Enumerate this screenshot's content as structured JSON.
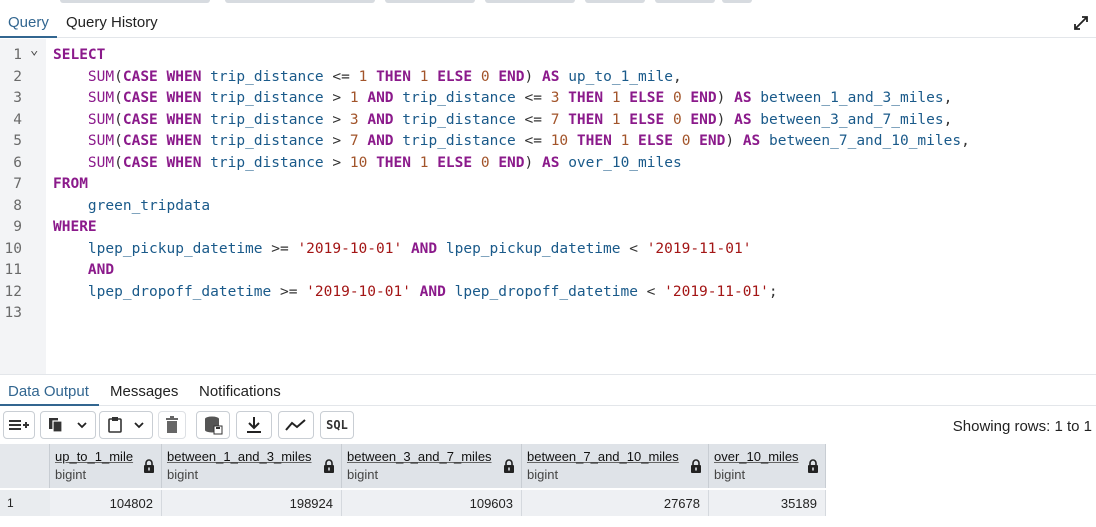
{
  "editor_tabs": [
    "Query",
    "Query History"
  ],
  "editor": {
    "lines": [
      {
        "n": "1",
        "fold": true,
        "tokens": [
          [
            "kw",
            "SELECT"
          ]
        ]
      },
      {
        "n": "2",
        "tokens": [
          [
            "sp",
            "    "
          ],
          [
            "fn",
            "SUM"
          ],
          [
            "op",
            "("
          ],
          [
            "kw",
            "CASE WHEN"
          ],
          [
            "op",
            " "
          ],
          [
            "id",
            "trip_distance"
          ],
          [
            "op",
            " <= "
          ],
          [
            "num",
            "1"
          ],
          [
            "op",
            " "
          ],
          [
            "kw",
            "THEN"
          ],
          [
            "op",
            " "
          ],
          [
            "num",
            "1"
          ],
          [
            "op",
            " "
          ],
          [
            "kw",
            "ELSE"
          ],
          [
            "op",
            " "
          ],
          [
            "num",
            "0"
          ],
          [
            "op",
            " "
          ],
          [
            "kw",
            "END"
          ],
          [
            "op",
            ") "
          ],
          [
            "kw",
            "AS"
          ],
          [
            "op",
            " "
          ],
          [
            "id",
            "up_to_1_mile"
          ],
          [
            "op",
            ","
          ]
        ]
      },
      {
        "n": "3",
        "tokens": [
          [
            "sp",
            "    "
          ],
          [
            "fn",
            "SUM"
          ],
          [
            "op",
            "("
          ],
          [
            "kw",
            "CASE WHEN"
          ],
          [
            "op",
            " "
          ],
          [
            "id",
            "trip_distance"
          ],
          [
            "op",
            " > "
          ],
          [
            "num",
            "1"
          ],
          [
            "op",
            " "
          ],
          [
            "kw",
            "AND"
          ],
          [
            "op",
            " "
          ],
          [
            "id",
            "trip_distance"
          ],
          [
            "op",
            " <= "
          ],
          [
            "num",
            "3"
          ],
          [
            "op",
            " "
          ],
          [
            "kw",
            "THEN"
          ],
          [
            "op",
            " "
          ],
          [
            "num",
            "1"
          ],
          [
            "op",
            " "
          ],
          [
            "kw",
            "ELSE"
          ],
          [
            "op",
            " "
          ],
          [
            "num",
            "0"
          ],
          [
            "op",
            " "
          ],
          [
            "kw",
            "END"
          ],
          [
            "op",
            ") "
          ],
          [
            "kw",
            "AS"
          ],
          [
            "op",
            " "
          ],
          [
            "id",
            "between_1_and_3_miles"
          ],
          [
            "op",
            ","
          ]
        ]
      },
      {
        "n": "4",
        "tokens": [
          [
            "sp",
            "    "
          ],
          [
            "fn",
            "SUM"
          ],
          [
            "op",
            "("
          ],
          [
            "kw",
            "CASE WHEN"
          ],
          [
            "op",
            " "
          ],
          [
            "id",
            "trip_distance"
          ],
          [
            "op",
            " > "
          ],
          [
            "num",
            "3"
          ],
          [
            "op",
            " "
          ],
          [
            "kw",
            "AND"
          ],
          [
            "op",
            " "
          ],
          [
            "id",
            "trip_distance"
          ],
          [
            "op",
            " <= "
          ],
          [
            "num",
            "7"
          ],
          [
            "op",
            " "
          ],
          [
            "kw",
            "THEN"
          ],
          [
            "op",
            " "
          ],
          [
            "num",
            "1"
          ],
          [
            "op",
            " "
          ],
          [
            "kw",
            "ELSE"
          ],
          [
            "op",
            " "
          ],
          [
            "num",
            "0"
          ],
          [
            "op",
            " "
          ],
          [
            "kw",
            "END"
          ],
          [
            "op",
            ") "
          ],
          [
            "kw",
            "AS"
          ],
          [
            "op",
            " "
          ],
          [
            "id",
            "between_3_and_7_miles"
          ],
          [
            "op",
            ","
          ]
        ]
      },
      {
        "n": "5",
        "tokens": [
          [
            "sp",
            "    "
          ],
          [
            "fn",
            "SUM"
          ],
          [
            "op",
            "("
          ],
          [
            "kw",
            "CASE WHEN"
          ],
          [
            "op",
            " "
          ],
          [
            "id",
            "trip_distance"
          ],
          [
            "op",
            " > "
          ],
          [
            "num",
            "7"
          ],
          [
            "op",
            " "
          ],
          [
            "kw",
            "AND"
          ],
          [
            "op",
            " "
          ],
          [
            "id",
            "trip_distance"
          ],
          [
            "op",
            " <= "
          ],
          [
            "num",
            "10"
          ],
          [
            "op",
            " "
          ],
          [
            "kw",
            "THEN"
          ],
          [
            "op",
            " "
          ],
          [
            "num",
            "1"
          ],
          [
            "op",
            " "
          ],
          [
            "kw",
            "ELSE"
          ],
          [
            "op",
            " "
          ],
          [
            "num",
            "0"
          ],
          [
            "op",
            " "
          ],
          [
            "kw",
            "END"
          ],
          [
            "op",
            ") "
          ],
          [
            "kw",
            "AS"
          ],
          [
            "op",
            " "
          ],
          [
            "id",
            "between_7_and_10_miles"
          ],
          [
            "op",
            ","
          ]
        ]
      },
      {
        "n": "6",
        "tokens": [
          [
            "sp",
            "    "
          ],
          [
            "fn",
            "SUM"
          ],
          [
            "op",
            "("
          ],
          [
            "kw",
            "CASE WHEN"
          ],
          [
            "op",
            " "
          ],
          [
            "id",
            "trip_distance"
          ],
          [
            "op",
            " > "
          ],
          [
            "num",
            "10"
          ],
          [
            "op",
            " "
          ],
          [
            "kw",
            "THEN"
          ],
          [
            "op",
            " "
          ],
          [
            "num",
            "1"
          ],
          [
            "op",
            " "
          ],
          [
            "kw",
            "ELSE"
          ],
          [
            "op",
            " "
          ],
          [
            "num",
            "0"
          ],
          [
            "op",
            " "
          ],
          [
            "kw",
            "END"
          ],
          [
            "op",
            ") "
          ],
          [
            "kw",
            "AS"
          ],
          [
            "op",
            " "
          ],
          [
            "id",
            "over_10_miles"
          ]
        ]
      },
      {
        "n": "7",
        "tokens": [
          [
            "kw",
            "FROM"
          ]
        ]
      },
      {
        "n": "8",
        "tokens": [
          [
            "sp",
            "    "
          ],
          [
            "id",
            "green_tripdata"
          ]
        ]
      },
      {
        "n": "9",
        "tokens": [
          [
            "kw",
            "WHERE"
          ]
        ]
      },
      {
        "n": "10",
        "tokens": [
          [
            "sp",
            "    "
          ],
          [
            "id",
            "lpep_pickup_datetime"
          ],
          [
            "op",
            " >= "
          ],
          [
            "str",
            "'2019-10-01'"
          ],
          [
            "op",
            " "
          ],
          [
            "kw",
            "AND"
          ],
          [
            "op",
            " "
          ],
          [
            "id",
            "lpep_pickup_datetime"
          ],
          [
            "op",
            " < "
          ],
          [
            "str",
            "'2019-11-01'"
          ]
        ]
      },
      {
        "n": "11",
        "tokens": [
          [
            "sp",
            "    "
          ],
          [
            "kw",
            "AND"
          ]
        ]
      },
      {
        "n": "12",
        "tokens": [
          [
            "sp",
            "    "
          ],
          [
            "id",
            "lpep_dropoff_datetime"
          ],
          [
            "op",
            " >= "
          ],
          [
            "str",
            "'2019-10-01'"
          ],
          [
            "op",
            " "
          ],
          [
            "kw",
            "AND"
          ],
          [
            "op",
            " "
          ],
          [
            "id",
            "lpep_dropoff_datetime"
          ],
          [
            "op",
            " < "
          ],
          [
            "str",
            "'2019-11-01'"
          ],
          [
            "op",
            ";"
          ]
        ]
      },
      {
        "n": "13",
        "tokens": []
      }
    ]
  },
  "results_tabs": [
    "Data Output",
    "Messages",
    "Notifications"
  ],
  "toolbar": {
    "sql_label": "SQL",
    "showing_rows": "Showing rows: 1 to 1"
  },
  "grid": {
    "columns": [
      {
        "name": "up_to_1_mile",
        "type": "bigint"
      },
      {
        "name": "between_1_and_3_miles",
        "type": "bigint"
      },
      {
        "name": "between_3_and_7_miles",
        "type": "bigint"
      },
      {
        "name": "between_7_and_10_miles",
        "type": "bigint"
      },
      {
        "name": "over_10_miles",
        "type": "bigint"
      }
    ],
    "rows": [
      {
        "n": "1",
        "values": [
          "104802",
          "198924",
          "109603",
          "27678",
          "35189"
        ]
      }
    ]
  },
  "colors": {
    "accent": "#326690",
    "keyword": "#8b1a8b",
    "identifier": "#1a5a8a",
    "number": "#a2542a",
    "string": "#a31515"
  }
}
